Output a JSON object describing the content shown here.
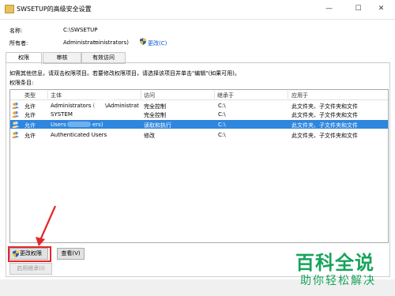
{
  "window": {
    "title": "SWSETUP的高级安全设置",
    "min_glyph": "—",
    "max_glyph": "☐",
    "close_glyph": "✕"
  },
  "info": {
    "name_label": "名称:",
    "name_value": "C:\\SWSETUP",
    "owner_label": "所有者:",
    "owner_value_left": "Administrato",
    "owner_value_right": "ministrators)",
    "change_link": "更改(C)"
  },
  "tabs": [
    {
      "label": "权限"
    },
    {
      "label": "审核"
    },
    {
      "label": "有效访问"
    }
  ],
  "permissions": {
    "hint": "如需其他信息，请双击权限项目。若要修改权限项目，请选择该项目并单击\"编辑\"(如果可用)。",
    "entries_label": "权限条目:",
    "headers": {
      "type": "类型",
      "principal": "主体",
      "access": "访问",
      "inherited": "继承于",
      "applies": "应用于"
    },
    "rows": [
      {
        "type": "允许",
        "principal": "Administrators (",
        "principal_tail": "\\Administrat",
        "access": "完全控制",
        "inherited": "C:\\",
        "applies": "此文件夹、子文件夹和文件"
      },
      {
        "type": "允许",
        "principal": "SYSTEM",
        "principal_tail": "",
        "access": "完全控制",
        "inherited": "C:\\",
        "applies": "此文件夹、子文件夹和文件"
      },
      {
        "type": "允许",
        "principal": "Users",
        "principal_tail": "ers)",
        "access": "读取和执行",
        "inherited": "C:\\",
        "applies": "此文件夹、子文件夹和文件"
      },
      {
        "type": "允许",
        "principal": "Authenticated Users",
        "principal_tail": "",
        "access": "修改",
        "inherited": "C:\\",
        "applies": "此文件夹、子文件夹和文件"
      }
    ],
    "change_permissions_button": "更改权限",
    "view_button": "查看(V)",
    "enable_inheritance_button": "启用继承(I)"
  },
  "watermark": {
    "big": "百科全说",
    "small": "助你轻松解决"
  },
  "colors": {
    "selection": "#2e86df",
    "highlight": "#e5262a",
    "watermark": "#17a35c"
  }
}
